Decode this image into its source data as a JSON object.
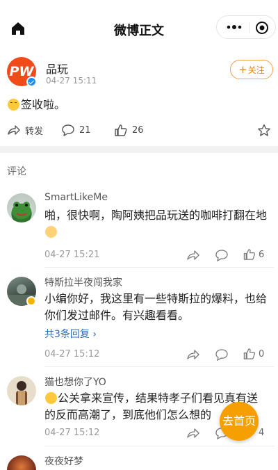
{
  "header": {
    "title": "微博正文"
  },
  "post": {
    "author": "品玩",
    "avatar_text": "PW",
    "time": "04-27 15:11",
    "follow_label": "关注",
    "text": "签收啦。",
    "actions": {
      "repost_label": "转发",
      "comment_count": "21",
      "like_count": "26"
    }
  },
  "comments_section_label": "评论",
  "comments": [
    {
      "name": "SmartLikeMe",
      "text": "啪，很快啊，陶阿姨把品玩送的咖啡打翻在地",
      "time": "04-27 15:21",
      "likes": "6"
    },
    {
      "name": "特斯拉半夜闯我家",
      "text": "小编你好，我这里有一些特斯拉的爆料，也给你们发过邮件。有兴趣看看。",
      "replies": "共3条回复",
      "time": "04-27 15:12",
      "likes": "0"
    },
    {
      "name": "猫也想你了YO",
      "text": "公关拿来宣传，结果特孝子们看见真有送的反而高潮了，到底他们怎么想的",
      "time": "04-27 15:12",
      "likes": "4"
    },
    {
      "name": "夜夜好梦"
    }
  ],
  "fab": {
    "label": "去首页"
  },
  "colors": {
    "accent_orange": "#f08300",
    "fab_orange": "#f5a000",
    "link_blue": "#2d6bb5",
    "verified_blue": "#1e8ef0",
    "brand_red": "#f24b1a"
  }
}
